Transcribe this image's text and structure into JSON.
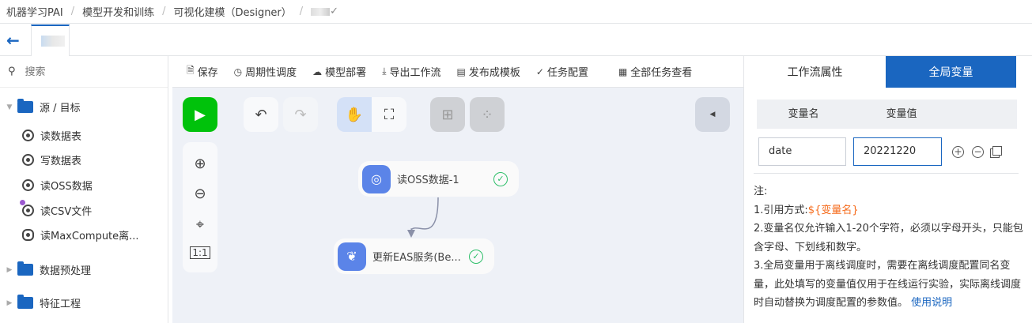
{
  "breadcrumb": [
    "机器学习PAI",
    "模型开发和训练",
    "可视化建模（Designer）"
  ],
  "sidebar": {
    "search_placeholder": "搜索",
    "groups": [
      {
        "label": "源 / 目标",
        "items": [
          "读数据表",
          "写数据表",
          "读OSS数据",
          "读CSV文件",
          "读MaxCompute离..."
        ]
      },
      {
        "label": "数据预处理"
      },
      {
        "label": "特征工程"
      }
    ]
  },
  "toolbar": [
    "保存",
    "周期性调度",
    "模型部署",
    "导出工作流",
    "发布成模板",
    "任务配置",
    "全部任务查看"
  ],
  "canvas": {
    "nodes": [
      {
        "label": "读OSS数据-1",
        "status": "success"
      },
      {
        "label": "更新EAS服务(Be...",
        "status": "success"
      }
    ]
  },
  "right_panel": {
    "tabs": [
      "工作流属性",
      "全局变量"
    ],
    "active_tab": "全局变量",
    "columns": [
      "变量名",
      "变量值"
    ],
    "variable": {
      "name": "date",
      "value": "20221220"
    },
    "note": {
      "title": "注:",
      "line1_prefix": "1.引用方式:",
      "line1_code": "${变量名}",
      "line2": "2.变量名仅允许输入1-20个字符，必须以字母开头，只能包含字母、下划线和数字。",
      "line3": "3.全局变量用于离线调度时，需要在离线调度配置同名变量，此处填写的变量值仅用于在线运行实验，实际离线调度时自动替换为调度配置的参数值。",
      "link": "使用说明"
    }
  },
  "colors": {
    "accent": "#1a66c0",
    "run": "#00c20b",
    "node_icon": "#5b84e8",
    "success": "#2fbf6a"
  }
}
